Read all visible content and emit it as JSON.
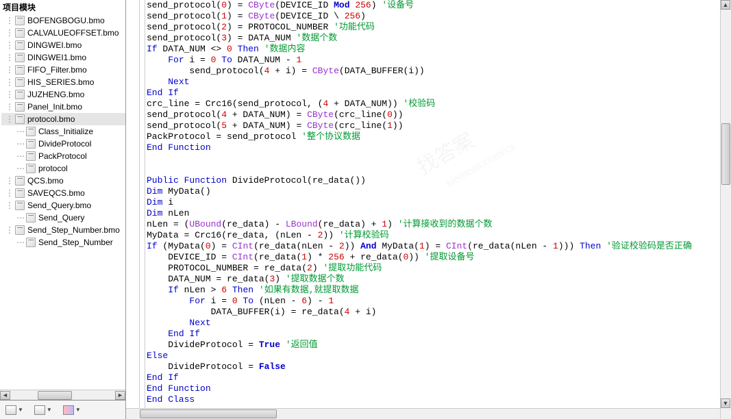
{
  "sidebar": {
    "header": "项目模块",
    "items": [
      {
        "label": "BOFENGBOGU.bmo",
        "sub": false,
        "selected": false
      },
      {
        "label": "CALVALUEOFFSET.bmo",
        "sub": false,
        "selected": false
      },
      {
        "label": "DINGWEI.bmo",
        "sub": false,
        "selected": false
      },
      {
        "label": "DINGWEI1.bmo",
        "sub": false,
        "selected": false
      },
      {
        "label": "FIFO_Filter.bmo",
        "sub": false,
        "selected": false
      },
      {
        "label": "HIS_SERIES.bmo",
        "sub": false,
        "selected": false
      },
      {
        "label": "JUZHENG.bmo",
        "sub": false,
        "selected": false
      },
      {
        "label": "Panel_Init.bmo",
        "sub": false,
        "selected": false
      },
      {
        "label": "protocol.bmo",
        "sub": false,
        "selected": true
      },
      {
        "label": "Class_Initialize",
        "sub": true,
        "selected": false
      },
      {
        "label": "DivideProtocol",
        "sub": true,
        "selected": false
      },
      {
        "label": "PackProtocol",
        "sub": true,
        "selected": false
      },
      {
        "label": "protocol",
        "sub": true,
        "selected": false
      },
      {
        "label": "QCS.bmo",
        "sub": false,
        "selected": false
      },
      {
        "label": "SAVEQCS.bmo",
        "sub": false,
        "selected": false
      },
      {
        "label": "Send_Query.bmo",
        "sub": false,
        "selected": false
      },
      {
        "label": "Send_Query",
        "sub": true,
        "selected": false
      },
      {
        "label": "Send_Step_Number.bmo",
        "sub": false,
        "selected": false
      },
      {
        "label": "Send_Step_Number",
        "sub": true,
        "selected": false
      }
    ]
  },
  "code_lines": [
    [
      {
        "t": "send_protocol(",
        "c": "id"
      },
      {
        "t": "0",
        "c": "num"
      },
      {
        "t": ") = ",
        "c": "id"
      },
      {
        "t": "CByte",
        "c": "func"
      },
      {
        "t": "(DEVICE_ID ",
        "c": "id"
      },
      {
        "t": "Mod",
        "c": "kw bold"
      },
      {
        "t": " ",
        "c": "id"
      },
      {
        "t": "256",
        "c": "num"
      },
      {
        "t": ") ",
        "c": "id"
      },
      {
        "t": "'设备号",
        "c": "cm"
      }
    ],
    [
      {
        "t": "send_protocol(",
        "c": "id"
      },
      {
        "t": "1",
        "c": "num"
      },
      {
        "t": ") = ",
        "c": "id"
      },
      {
        "t": "CByte",
        "c": "func"
      },
      {
        "t": "(DEVICE_ID \\ ",
        "c": "id"
      },
      {
        "t": "256",
        "c": "num"
      },
      {
        "t": ")",
        "c": "id"
      }
    ],
    [
      {
        "t": "send_protocol(",
        "c": "id"
      },
      {
        "t": "2",
        "c": "num"
      },
      {
        "t": ") = PROTOCOL_NUMBER ",
        "c": "id"
      },
      {
        "t": "'功能代码",
        "c": "cm"
      }
    ],
    [
      {
        "t": "send_protocol(",
        "c": "id"
      },
      {
        "t": "3",
        "c": "num"
      },
      {
        "t": ") = DATA_NUM ",
        "c": "id"
      },
      {
        "t": "'数据个数",
        "c": "cm"
      }
    ],
    [
      {
        "t": "If",
        "c": "kw"
      },
      {
        "t": " DATA_NUM <> ",
        "c": "id"
      },
      {
        "t": "0",
        "c": "num"
      },
      {
        "t": " ",
        "c": "id"
      },
      {
        "t": "Then",
        "c": "kw"
      },
      {
        "t": " ",
        "c": "id"
      },
      {
        "t": "'数据内容",
        "c": "cm"
      }
    ],
    [
      {
        "t": "    ",
        "c": "id"
      },
      {
        "t": "For",
        "c": "kw"
      },
      {
        "t": " i = ",
        "c": "id"
      },
      {
        "t": "0",
        "c": "num"
      },
      {
        "t": " ",
        "c": "id"
      },
      {
        "t": "To",
        "c": "kw"
      },
      {
        "t": " DATA_NUM - ",
        "c": "id"
      },
      {
        "t": "1",
        "c": "num"
      }
    ],
    [
      {
        "t": "        send_protocol(",
        "c": "id"
      },
      {
        "t": "4",
        "c": "num"
      },
      {
        "t": " + i) = ",
        "c": "id"
      },
      {
        "t": "CByte",
        "c": "func"
      },
      {
        "t": "(DATA_BUFFER(i))",
        "c": "id"
      }
    ],
    [
      {
        "t": "    ",
        "c": "id"
      },
      {
        "t": "Next",
        "c": "kw"
      }
    ],
    [
      {
        "t": "End If",
        "c": "kw"
      }
    ],
    [
      {
        "t": "crc_line = Crc16(send_protocol, (",
        "c": "id"
      },
      {
        "t": "4",
        "c": "num"
      },
      {
        "t": " + DATA_NUM)) ",
        "c": "id"
      },
      {
        "t": "'校验码",
        "c": "cm"
      }
    ],
    [
      {
        "t": "send_protocol(",
        "c": "id"
      },
      {
        "t": "4",
        "c": "num"
      },
      {
        "t": " + DATA_NUM) = ",
        "c": "id"
      },
      {
        "t": "CByte",
        "c": "func"
      },
      {
        "t": "(crc_line(",
        "c": "id"
      },
      {
        "t": "0",
        "c": "num"
      },
      {
        "t": "))",
        "c": "id"
      }
    ],
    [
      {
        "t": "send_protocol(",
        "c": "id"
      },
      {
        "t": "5",
        "c": "num"
      },
      {
        "t": " + DATA_NUM) = ",
        "c": "id"
      },
      {
        "t": "CByte",
        "c": "func"
      },
      {
        "t": "(crc_line(",
        "c": "id"
      },
      {
        "t": "1",
        "c": "num"
      },
      {
        "t": "))",
        "c": "id"
      }
    ],
    [
      {
        "t": "PackProtocol = send_protocol ",
        "c": "id"
      },
      {
        "t": "'整个协议数据",
        "c": "cm"
      }
    ],
    [
      {
        "t": "End Function",
        "c": "kw"
      }
    ],
    [
      {
        "t": "",
        "c": "id"
      }
    ],
    [
      {
        "t": "",
        "c": "id"
      }
    ],
    [
      {
        "t": "Public Function",
        "c": "kw"
      },
      {
        "t": " DivideProtocol(re_data())",
        "c": "id"
      }
    ],
    [
      {
        "t": "Dim",
        "c": "kw"
      },
      {
        "t": " MyData()",
        "c": "id"
      }
    ],
    [
      {
        "t": "Dim",
        "c": "kw"
      },
      {
        "t": " i",
        "c": "id"
      }
    ],
    [
      {
        "t": "Dim",
        "c": "kw"
      },
      {
        "t": " nLen",
        "c": "id"
      }
    ],
    [
      {
        "t": "nLen = (",
        "c": "id"
      },
      {
        "t": "UBound",
        "c": "func"
      },
      {
        "t": "(re_data) - ",
        "c": "id"
      },
      {
        "t": "LBound",
        "c": "func"
      },
      {
        "t": "(re_data) + ",
        "c": "id"
      },
      {
        "t": "1",
        "c": "num"
      },
      {
        "t": ") ",
        "c": "id"
      },
      {
        "t": "'计算接收到的数据个数",
        "c": "cm"
      }
    ],
    [
      {
        "t": "MyData = Crc16(re_data, (nLen - ",
        "c": "id"
      },
      {
        "t": "2",
        "c": "num"
      },
      {
        "t": ")) ",
        "c": "id"
      },
      {
        "t": "'计算校验码",
        "c": "cm"
      }
    ],
    [
      {
        "t": "If",
        "c": "kw"
      },
      {
        "t": " (MyData(",
        "c": "id"
      },
      {
        "t": "0",
        "c": "num"
      },
      {
        "t": ") = ",
        "c": "id"
      },
      {
        "t": "CInt",
        "c": "func"
      },
      {
        "t": "(re_data(nLen - ",
        "c": "id"
      },
      {
        "t": "2",
        "c": "num"
      },
      {
        "t": ")) ",
        "c": "id"
      },
      {
        "t": "And",
        "c": "kw bold"
      },
      {
        "t": " MyData(",
        "c": "id"
      },
      {
        "t": "1",
        "c": "num"
      },
      {
        "t": ") = ",
        "c": "id"
      },
      {
        "t": "CInt",
        "c": "func"
      },
      {
        "t": "(re_data(nLen - ",
        "c": "id"
      },
      {
        "t": "1",
        "c": "num"
      },
      {
        "t": "))) ",
        "c": "id"
      },
      {
        "t": "Then",
        "c": "kw"
      },
      {
        "t": " ",
        "c": "id"
      },
      {
        "t": "'验证校验码是否正确",
        "c": "cm"
      }
    ],
    [
      {
        "t": "    DEVICE_ID = ",
        "c": "id"
      },
      {
        "t": "CInt",
        "c": "func"
      },
      {
        "t": "(re_data(",
        "c": "id"
      },
      {
        "t": "1",
        "c": "num"
      },
      {
        "t": ") * ",
        "c": "id"
      },
      {
        "t": "256",
        "c": "num"
      },
      {
        "t": " + re_data(",
        "c": "id"
      },
      {
        "t": "0",
        "c": "num"
      },
      {
        "t": ")) ",
        "c": "id"
      },
      {
        "t": "'提取设备号",
        "c": "cm"
      }
    ],
    [
      {
        "t": "    PROTOCOL_NUMBER = re_data(",
        "c": "id"
      },
      {
        "t": "2",
        "c": "num"
      },
      {
        "t": ") ",
        "c": "id"
      },
      {
        "t": "'提取功能代码",
        "c": "cm"
      }
    ],
    [
      {
        "t": "    DATA_NUM = re_data(",
        "c": "id"
      },
      {
        "t": "3",
        "c": "num"
      },
      {
        "t": ") ",
        "c": "id"
      },
      {
        "t": "'提取数据个数",
        "c": "cm"
      }
    ],
    [
      {
        "t": "    ",
        "c": "id"
      },
      {
        "t": "If",
        "c": "kw"
      },
      {
        "t": " nLen > ",
        "c": "id"
      },
      {
        "t": "6",
        "c": "num"
      },
      {
        "t": " ",
        "c": "id"
      },
      {
        "t": "Then",
        "c": "kw"
      },
      {
        "t": " ",
        "c": "id"
      },
      {
        "t": "'如果有数据,就提取数据",
        "c": "cm"
      }
    ],
    [
      {
        "t": "        ",
        "c": "id"
      },
      {
        "t": "For",
        "c": "kw"
      },
      {
        "t": " i = ",
        "c": "id"
      },
      {
        "t": "0",
        "c": "num"
      },
      {
        "t": " ",
        "c": "id"
      },
      {
        "t": "To",
        "c": "kw"
      },
      {
        "t": " (nLen - ",
        "c": "id"
      },
      {
        "t": "6",
        "c": "num"
      },
      {
        "t": ") - ",
        "c": "id"
      },
      {
        "t": "1",
        "c": "num"
      }
    ],
    [
      {
        "t": "            DATA_BUFFER(i) = re_data(",
        "c": "id"
      },
      {
        "t": "4",
        "c": "num"
      },
      {
        "t": " + i)",
        "c": "id"
      }
    ],
    [
      {
        "t": "        ",
        "c": "id"
      },
      {
        "t": "Next",
        "c": "kw"
      }
    ],
    [
      {
        "t": "    ",
        "c": "id"
      },
      {
        "t": "End If",
        "c": "kw"
      }
    ],
    [
      {
        "t": "    DivideProtocol = ",
        "c": "id"
      },
      {
        "t": "True",
        "c": "kw bold"
      },
      {
        "t": " ",
        "c": "id"
      },
      {
        "t": "'返回值",
        "c": "cm"
      }
    ],
    [
      {
        "t": "Else",
        "c": "kw"
      }
    ],
    [
      {
        "t": "    DivideProtocol = ",
        "c": "id"
      },
      {
        "t": "False",
        "c": "kw bold"
      }
    ],
    [
      {
        "t": "End If",
        "c": "kw"
      }
    ],
    [
      {
        "t": "End Function",
        "c": "kw"
      }
    ],
    [
      {
        "t": "End Class",
        "c": "kw"
      }
    ]
  ],
  "watermarks": [
    "找答案",
    "siemens.com/cs"
  ]
}
